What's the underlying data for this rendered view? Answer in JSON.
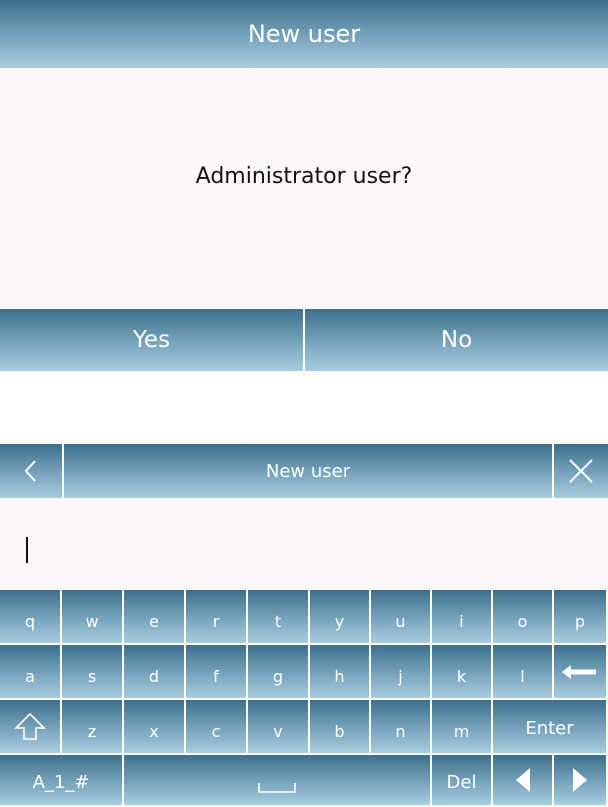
{
  "dialog": {
    "title": "New user",
    "question": "Administrator user?",
    "yes_label": "Yes",
    "no_label": "No"
  },
  "keyboard": {
    "title": "New user",
    "input_value": "",
    "rows": [
      [
        "q",
        "w",
        "e",
        "r",
        "t",
        "y",
        "u",
        "i",
        "o",
        "p"
      ],
      [
        "a",
        "s",
        "d",
        "f",
        "g",
        "h",
        "j",
        "k",
        "l"
      ],
      [
        "z",
        "x",
        "c",
        "v",
        "b",
        "n",
        "m"
      ]
    ],
    "enter_label": "Enter",
    "symbols_label": "A_1_#",
    "del_label": "Del",
    "icons": {
      "back": "chevron-left-icon",
      "close": "close-icon",
      "backspace": "backspace-arrow-icon",
      "shift": "shift-arrow-icon",
      "space": "space-bar-icon",
      "left": "arrow-left-icon",
      "right": "arrow-right-icon"
    }
  },
  "colors": {
    "bar_top": "#3e6e8a",
    "bar_bottom": "#a9cde0",
    "panel_bg": "#fdf8fb",
    "text_dark": "#111111"
  }
}
